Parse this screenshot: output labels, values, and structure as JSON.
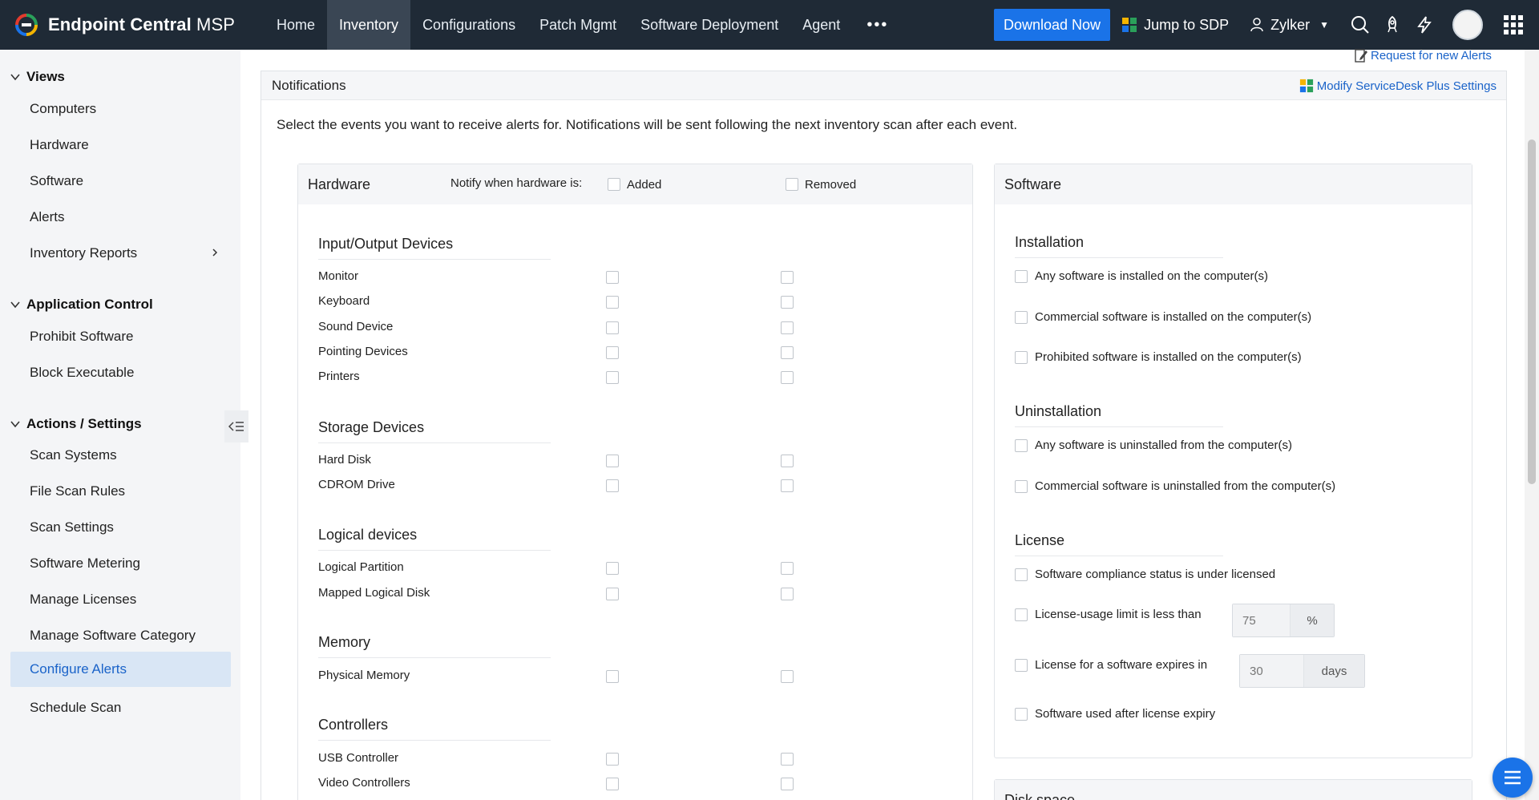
{
  "brand": {
    "name_bold": "Endpoint Central",
    "name_light": " MSP"
  },
  "nav": [
    {
      "label": "Home"
    },
    {
      "label": "Inventory",
      "active": true
    },
    {
      "label": "Configurations"
    },
    {
      "label": "Patch Mgmt"
    },
    {
      "label": "Software Deployment"
    },
    {
      "label": "Agent"
    }
  ],
  "topbar": {
    "more": "•••",
    "download_label": "Download Now",
    "sdp_label": "Jump to SDP",
    "user_name": "Zylker",
    "accent": "#1a73e8",
    "bg": "#1f2a36"
  },
  "sidebar": {
    "views_title": "Views",
    "views": [
      "Computers",
      "Hardware",
      "Software",
      "Alerts",
      "Inventory Reports"
    ],
    "appcontrol_title": "Application Control",
    "appcontrol": [
      "Prohibit Software",
      "Block Executable"
    ],
    "actions_title": "Actions / Settings",
    "actions": [
      "Scan Systems",
      "File Scan Rules",
      "Scan Settings",
      "Software Metering",
      "Manage Licenses",
      "Manage Software Category",
      "Configure Alerts",
      "Schedule Scan"
    ],
    "active_item": "Configure Alerts"
  },
  "main": {
    "request_link": "Request for new Alerts",
    "panel_title": "Notifications",
    "modify_link": "Modify ServiceDesk Plus Settings",
    "intro": "Select the events you want to receive alerts for. Notifications will be sent following the next inventory scan after each event."
  },
  "hardware": {
    "title": "Hardware",
    "notify_label": "Notify when hardware is:",
    "added_label": "Added",
    "removed_label": "Removed",
    "sections": [
      {
        "title": "Input/Output Devices",
        "items": [
          "Monitor",
          "Keyboard",
          "Sound Device",
          "Pointing Devices",
          "Printers"
        ]
      },
      {
        "title": "Storage Devices",
        "items": [
          "Hard Disk",
          "CDROM Drive"
        ]
      },
      {
        "title": "Logical devices",
        "items": [
          "Logical Partition",
          "Mapped Logical Disk"
        ]
      },
      {
        "title": "Memory",
        "items": [
          "Physical Memory"
        ]
      },
      {
        "title": "Controllers",
        "items": [
          "USB Controller",
          "Video Controllers"
        ]
      }
    ]
  },
  "software": {
    "title": "Software",
    "installation_title": "Installation",
    "installation": [
      "Any software is installed on the computer(s)",
      "Commercial software is installed on the computer(s)",
      "Prohibited software is installed on the computer(s)"
    ],
    "uninstallation_title": "Uninstallation",
    "uninstallation": [
      "Any software is uninstalled from the computer(s)",
      "Commercial software is uninstalled from the computer(s)"
    ],
    "license_title": "License",
    "license": {
      "under_licensed": "Software compliance status is under licensed",
      "usage_limit": "License-usage limit is less than",
      "usage_value": "75",
      "usage_unit": "%",
      "expires_in": "License for a software expires in",
      "expires_value": "30",
      "expires_unit": "days",
      "used_after_expiry": "Software used after license expiry"
    },
    "diskspace_title": "Disk space"
  }
}
